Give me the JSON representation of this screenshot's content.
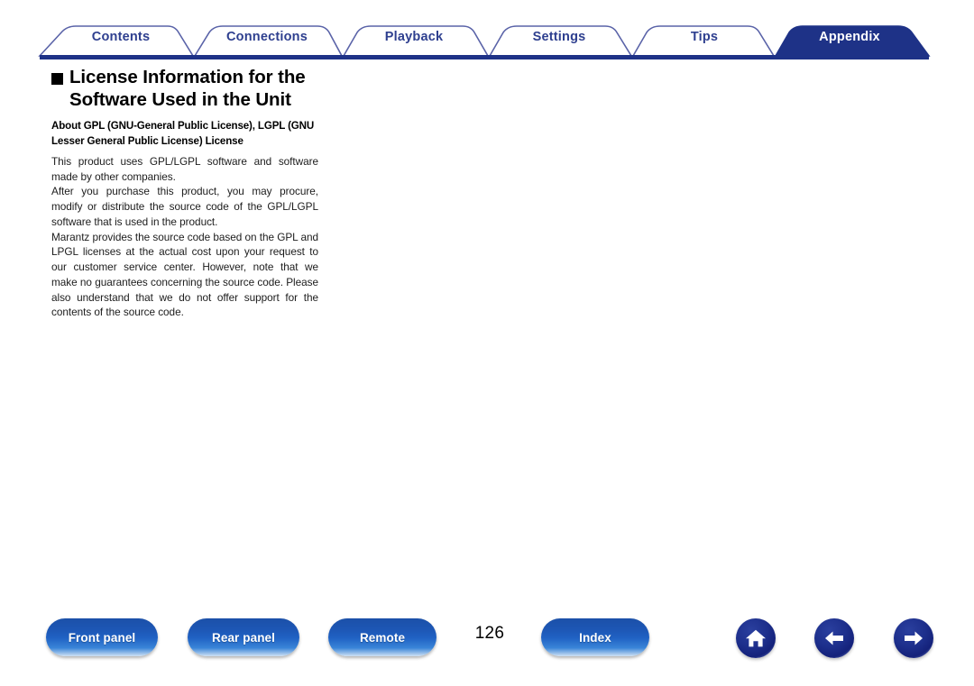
{
  "tabs": [
    {
      "label": "Contents",
      "active": false,
      "name": "tab-contents"
    },
    {
      "label": "Connections",
      "active": false,
      "name": "tab-connections"
    },
    {
      "label": "Playback",
      "active": false,
      "name": "tab-playback"
    },
    {
      "label": "Settings",
      "active": false,
      "name": "tab-settings"
    },
    {
      "label": "Tips",
      "active": false,
      "name": "tab-tips"
    },
    {
      "label": "Appendix",
      "active": true,
      "name": "tab-appendix"
    }
  ],
  "content": {
    "title": "License Information for the Software Used in the Unit",
    "subheading": "About GPL (GNU-General Public License), LGPL (GNU Lesser General Public License) License",
    "paragraphs": [
      "This product uses GPL/LGPL software and software made by other companies.",
      "After you purchase this product, you may procure, modify or distribute the source code of the GPL/LGPL software that is used in the product.",
      "Marantz provides the source code based on the GPL and LPGL licenses at the actual cost upon your request to our customer service center. However, note that we make no guarantees concerning the source code. Please also understand that we do not offer support for the contents of the source code."
    ]
  },
  "footer": {
    "buttons": [
      {
        "label": "Front panel",
        "name": "front-panel-button"
      },
      {
        "label": "Rear panel",
        "name": "rear-panel-button"
      },
      {
        "label": "Remote",
        "name": "remote-button"
      },
      {
        "label": "Index",
        "name": "index-button"
      }
    ],
    "page_number": "126",
    "icons": [
      {
        "name": "home-icon",
        "glyph": "home"
      },
      {
        "name": "arrow-left-icon",
        "glyph": "arrow-left"
      },
      {
        "name": "arrow-right-icon",
        "glyph": "arrow-right"
      }
    ]
  },
  "colors": {
    "tab_outline": "#5a63a8",
    "tab_text": "#2e3f8f",
    "active_tab_fill": "#1e3287",
    "rule": "#1e3287",
    "button_blue": "#1d56b4"
  }
}
